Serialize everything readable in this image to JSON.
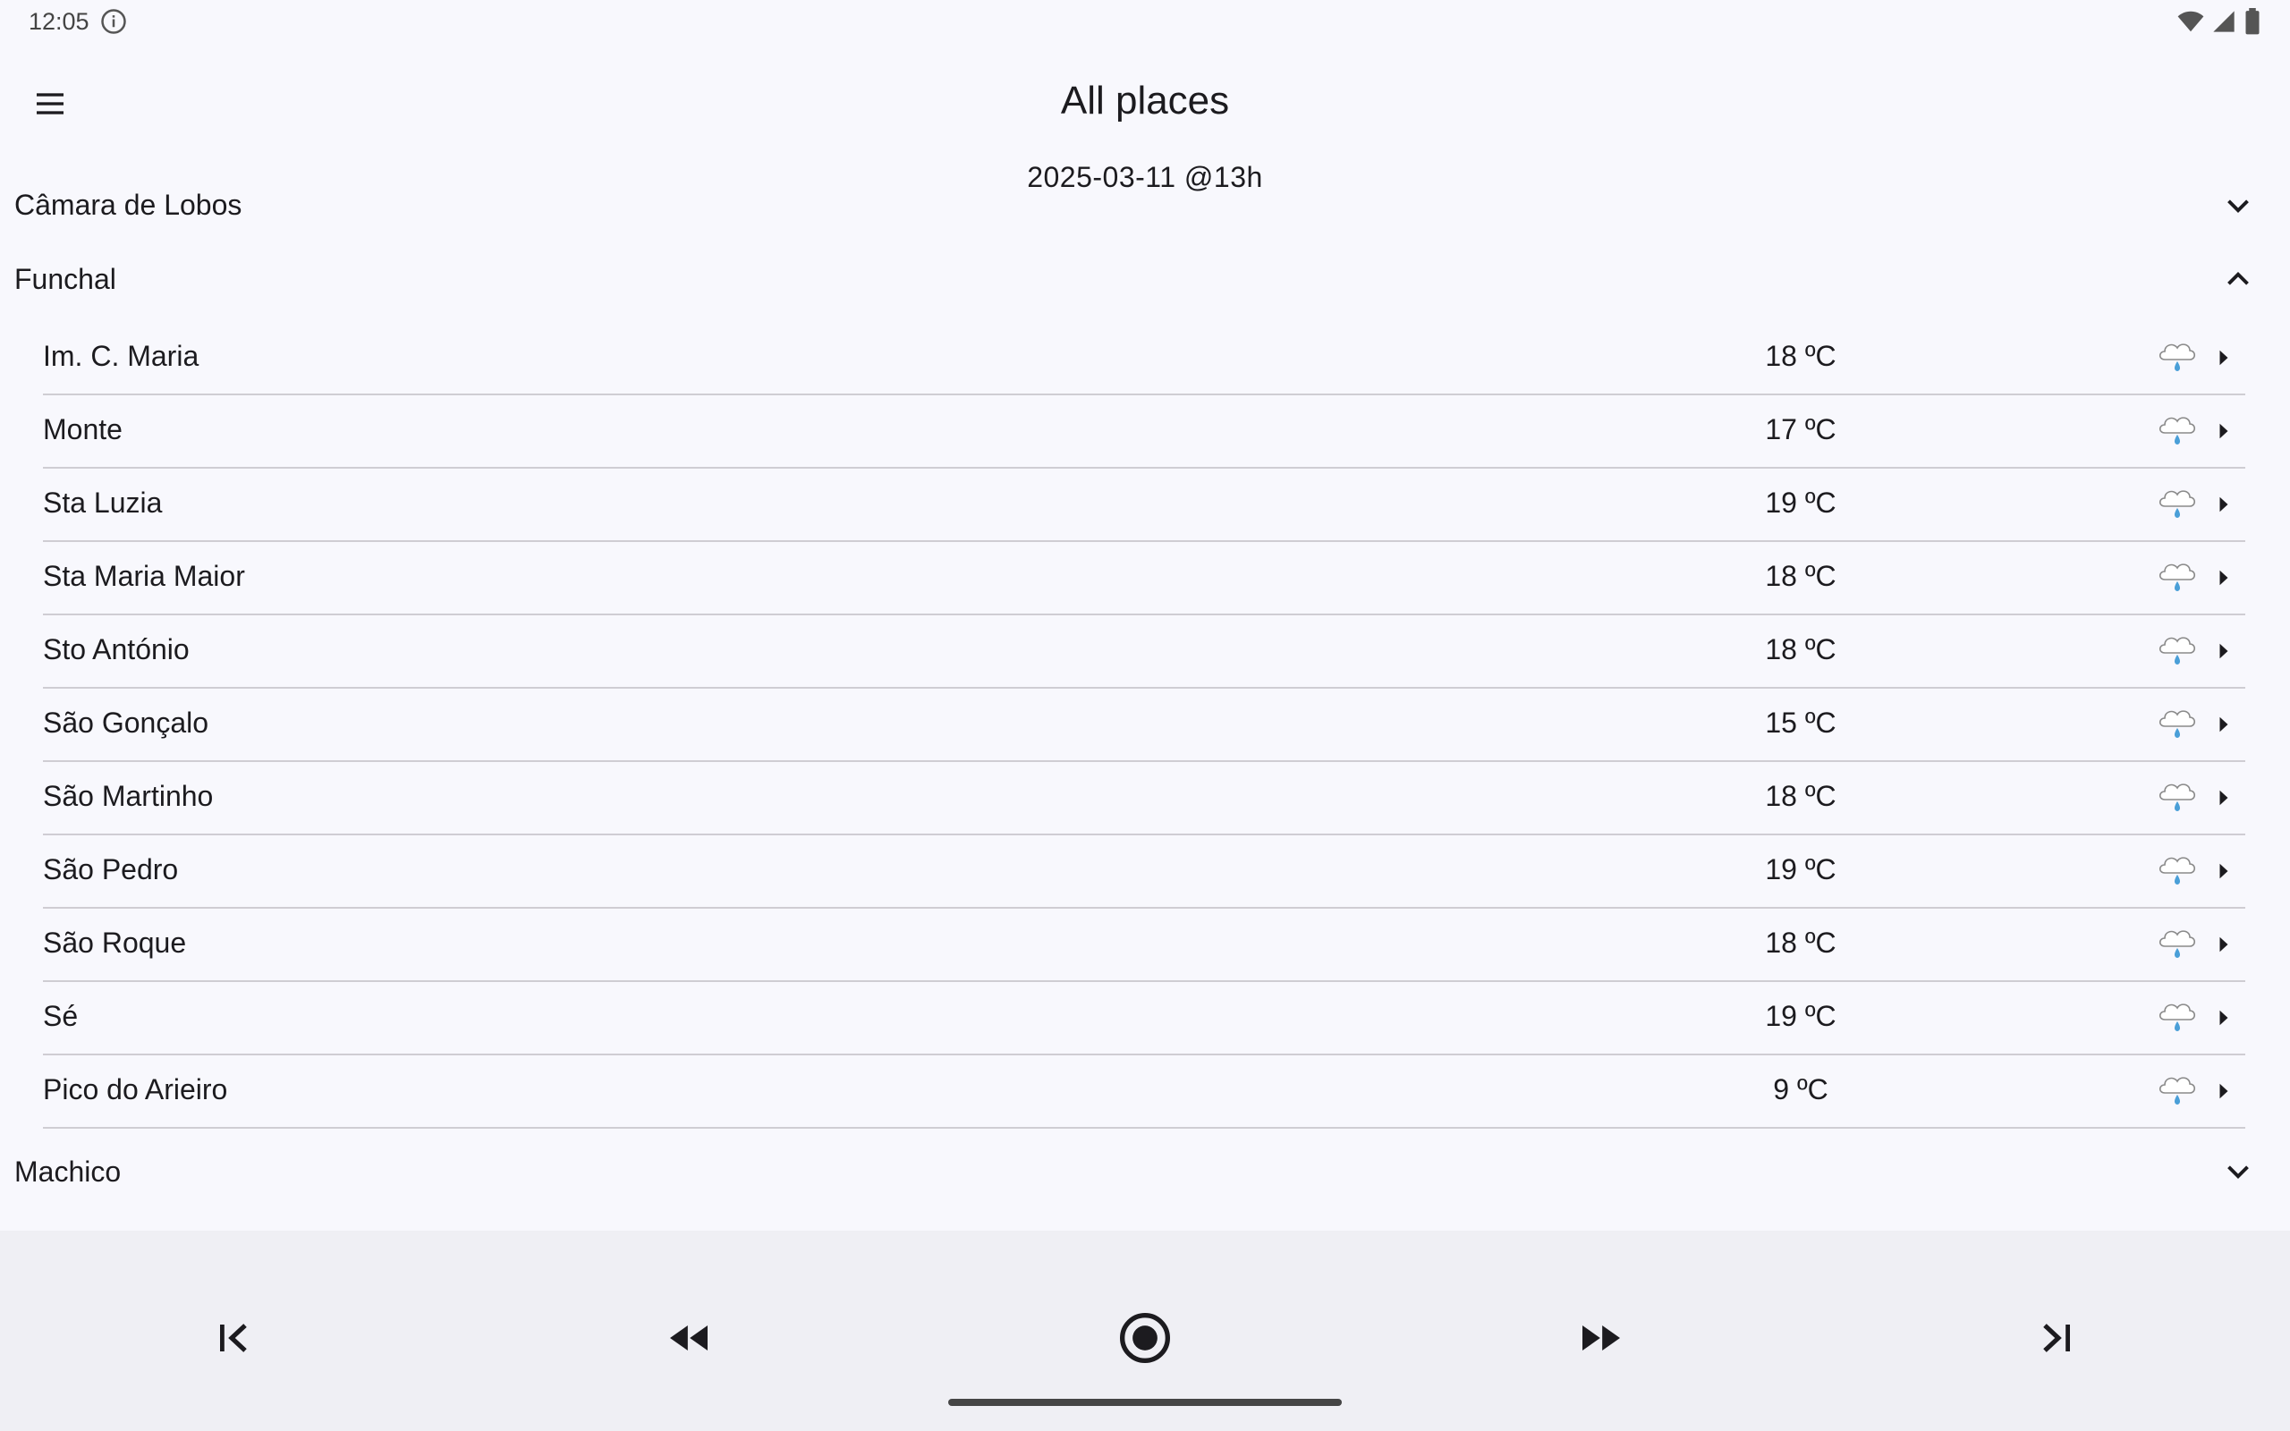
{
  "status": {
    "time": "12:05"
  },
  "header": {
    "title": "All places",
    "date": "2025-03-11 @13h"
  },
  "groups": {
    "camara": {
      "label": "Câmara de Lobos"
    },
    "funchal": {
      "label": "Funchal"
    },
    "machico": {
      "label": "Machico"
    }
  },
  "places": [
    {
      "name": "Im. C. Maria",
      "temp": "18 ºC",
      "icon": "rain-cloud-icon"
    },
    {
      "name": "Monte",
      "temp": "17 ºC",
      "icon": "rain-cloud-icon"
    },
    {
      "name": "Sta Luzia",
      "temp": "19 ºC",
      "icon": "rain-cloud-icon"
    },
    {
      "name": "Sta Maria Maior",
      "temp": "18 ºC",
      "icon": "rain-cloud-icon"
    },
    {
      "name": "Sto António",
      "temp": "18 ºC",
      "icon": "rain-cloud-icon"
    },
    {
      "name": "São Gonçalo",
      "temp": "15 ºC",
      "icon": "rain-cloud-icon"
    },
    {
      "name": "São Martinho",
      "temp": "18 ºC",
      "icon": "rain-cloud-icon"
    },
    {
      "name": "São Pedro",
      "temp": "19 ºC",
      "icon": "rain-cloud-icon"
    },
    {
      "name": "São Roque",
      "temp": "18 ºC",
      "icon": "rain-cloud-icon"
    },
    {
      "name": "Sé",
      "temp": "19 ºC",
      "icon": "rain-cloud-icon"
    },
    {
      "name": "Pico do Arieiro",
      "temp": "9 ºC",
      "icon": "rain-cloud-icon"
    }
  ],
  "nav": {
    "icons": [
      "skip-first-icon",
      "rewind-icon",
      "record-icon",
      "fast-forward-icon",
      "skip-last-icon"
    ]
  },
  "colors": {
    "background": "#f8f8fd",
    "bottom_bar": "#efeff4",
    "divider": "#cfcdd3",
    "rain": "#4a9fd8"
  }
}
